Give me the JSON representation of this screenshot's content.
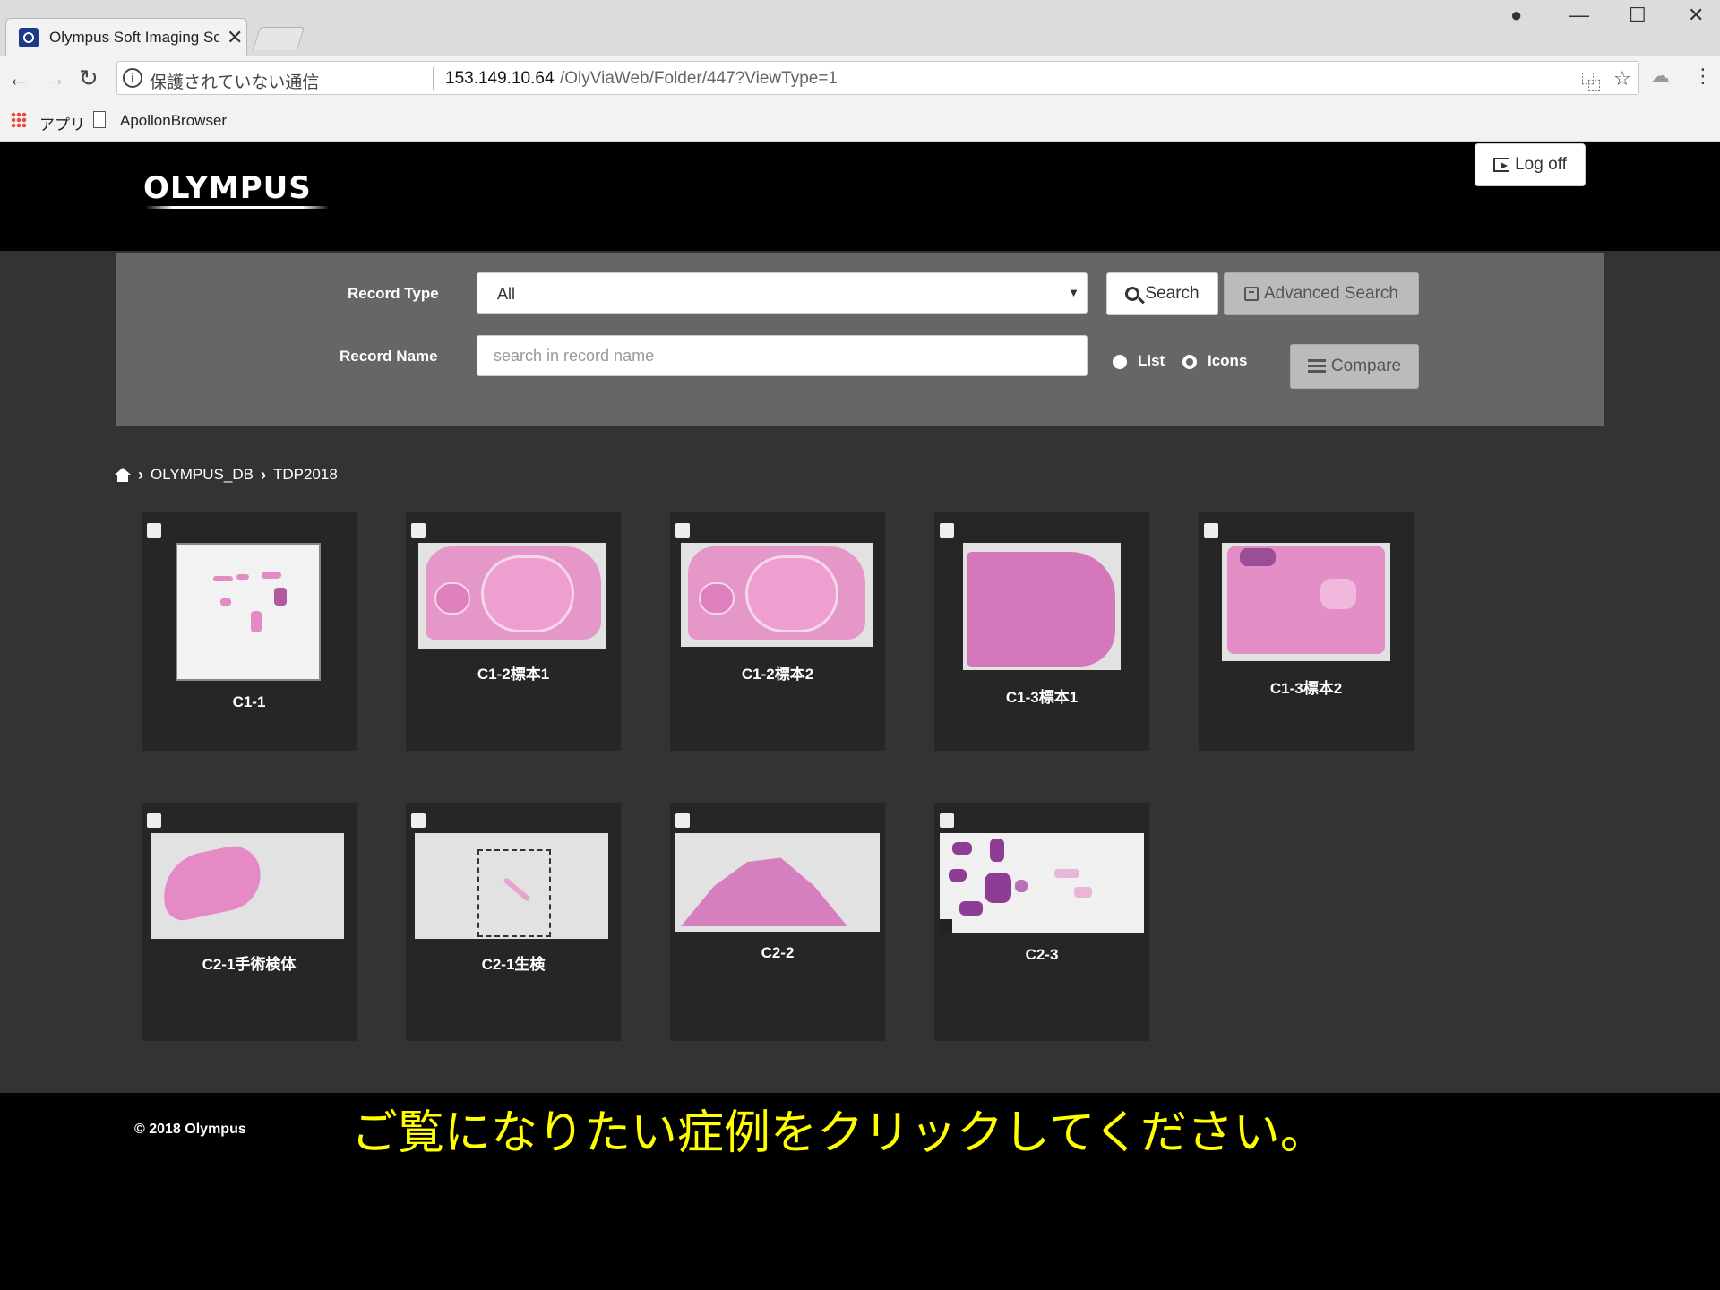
{
  "browser": {
    "tab_title": "Olympus Soft Imaging Sc",
    "address_insecure": "保護されていない通信",
    "address_host": "153.149.10.64",
    "address_path": "/OlyViaWeb/Folder/447?ViewType=1",
    "bookmarks": [
      "アプリ",
      "ApollonBrowser"
    ]
  },
  "header": {
    "logo": "OLYMPUS",
    "logoff_label": "Log off"
  },
  "search": {
    "record_type_label": "Record Type",
    "record_type_value": "All",
    "record_name_label": "Record Name",
    "record_name_placeholder": "search in record name",
    "search_label": "Search",
    "advanced_label": "Advanced Search",
    "compare_label": "Compare",
    "view_options": [
      "List",
      "Icons"
    ],
    "view_selected": "Icons"
  },
  "breadcrumb": [
    "OLYMPUS_DB",
    "TDP2018"
  ],
  "records": [
    {
      "name": "C1-1"
    },
    {
      "name": "C1-2標本1"
    },
    {
      "name": "C1-2標本2"
    },
    {
      "name": "C1-3標本1"
    },
    {
      "name": "C1-3標本2"
    },
    {
      "name": "C2-1手術検体"
    },
    {
      "name": "C2-1生検"
    },
    {
      "name": "C2-2"
    },
    {
      "name": "C2-3"
    }
  ],
  "footer": {
    "copyright": "© 2018 Olympus",
    "caption": "ご覧になりたい症例をクリックしてください。"
  },
  "colors": {
    "page_bg": "#333333",
    "panel_bg": "#666666",
    "card_bg": "#262626",
    "tissue_pink": "#e48bc4",
    "caption_yellow": "#ffff00"
  }
}
